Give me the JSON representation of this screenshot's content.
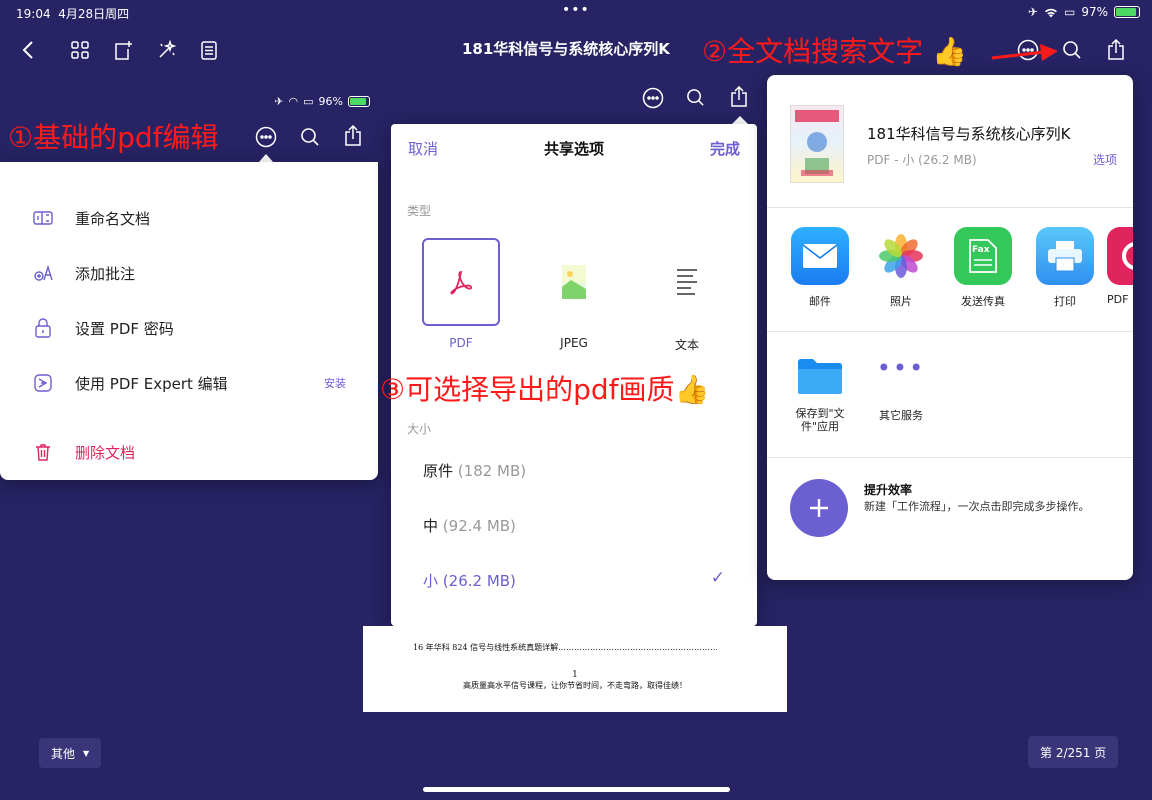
{
  "status": {
    "time": "19:04",
    "date": "4月28日周四",
    "dots": "•••",
    "battery": "97%"
  },
  "toolbar": {
    "title": "181华科信号与系统核心序列K"
  },
  "annotations": {
    "a1": "①基础的pdf编辑",
    "a2": "②全文档搜索文字",
    "a3": "③可选择导出的pdf画质",
    "thumb": "👍"
  },
  "left_popover": {
    "battery": "96%",
    "items": [
      {
        "label": "重命名文档",
        "icon": "rename-icon"
      },
      {
        "label": "添加批注",
        "icon": "annotate-icon"
      },
      {
        "label": "设置 PDF 密码",
        "icon": "lock-icon"
      },
      {
        "label": "使用 PDF Expert 编辑",
        "icon": "pdf-expert-icon",
        "badge": "安装"
      },
      {
        "label": "删除文档",
        "icon": "trash-icon"
      }
    ]
  },
  "share_options": {
    "cancel": "取消",
    "title": "共享选项",
    "done": "完成",
    "type_section": "类型",
    "types": [
      "PDF",
      "JPEG",
      "文本"
    ],
    "size_section": "大小",
    "sizes": [
      {
        "label": "原件",
        "size": "(182 MB)"
      },
      {
        "label": "中",
        "size": "(92.4 MB)"
      },
      {
        "label": "小",
        "size": "(26.2 MB)",
        "selected": true
      }
    ],
    "check": "✓"
  },
  "page_fragment": {
    "line1": "16 年华科 824 信号与线性系统真题详解…………………………………………………………………165",
    "page_no": "1",
    "slogan": "高质量高水平信号课程，让你节省时间，不走弯路，取得佳绩！"
  },
  "ios_share": {
    "doc_title": "181华科信号与系统核心序列K",
    "doc_meta": "PDF - 小 (26.2 MB)",
    "options": "选项",
    "apps": [
      "邮件",
      "照片",
      "发送传真",
      "打印",
      "PDF"
    ],
    "fax_label": "Fax",
    "actions": [
      {
        "label": "保存到\"文件\"应用"
      },
      {
        "label": "其它服务"
      }
    ],
    "boost_title": "提升效率",
    "boost_desc": "新建「工作流程」，一次点击即完成多步操作。"
  },
  "bottom": {
    "mode": "其他",
    "page": "第 2/251 页"
  },
  "colors": {
    "accent": "#6b5fd1",
    "danger": "#e0245e",
    "background": "#272364",
    "annotation": "#ff1a1a"
  }
}
